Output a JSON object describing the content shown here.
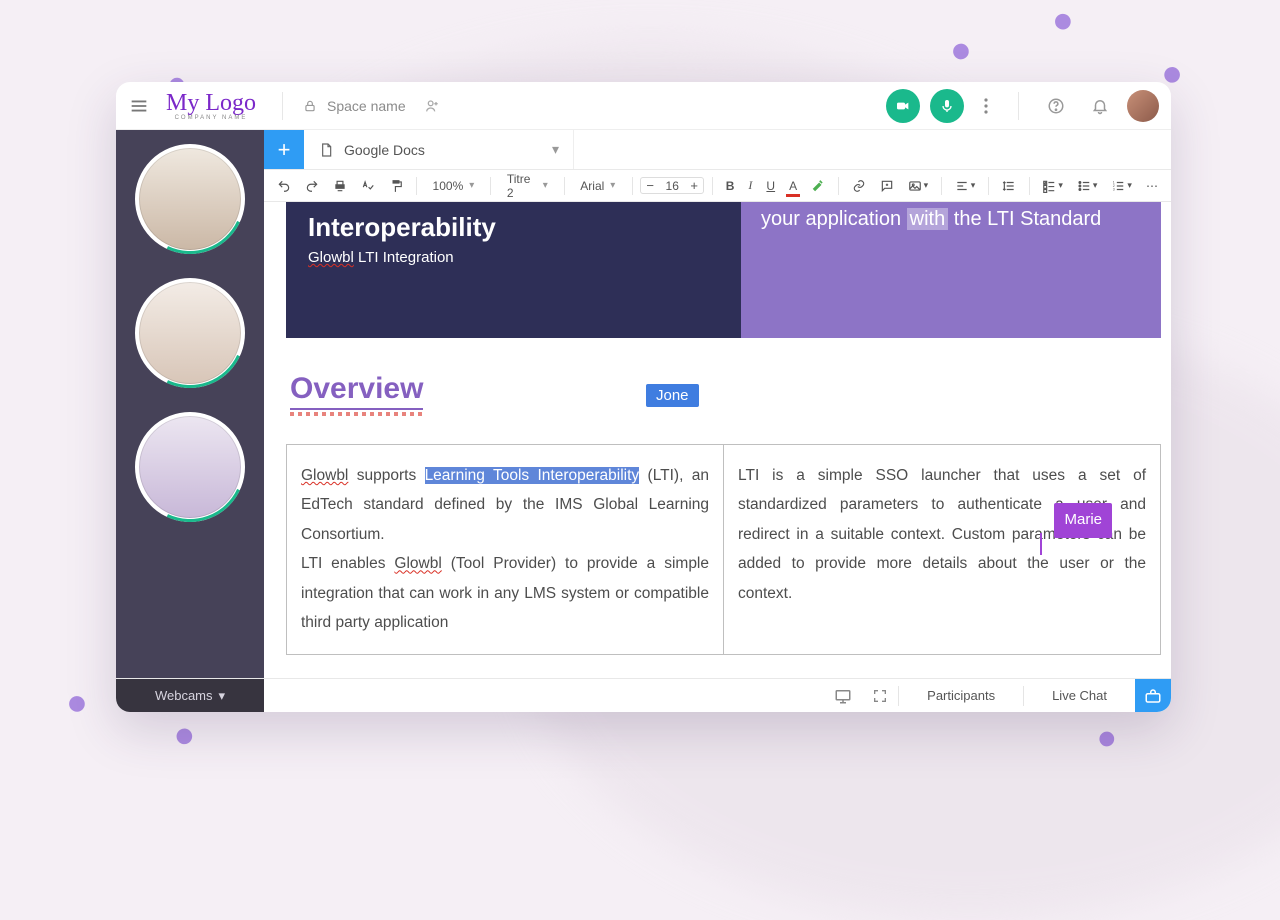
{
  "logo": {
    "main": "My Logo",
    "sub": "COMPANY NAME"
  },
  "topbar": {
    "space_name": "Space name"
  },
  "tab": {
    "source_label": "Google Docs"
  },
  "toolbar": {
    "zoom": "100%",
    "style": "Titre 2",
    "font": "Arial",
    "font_size": "16"
  },
  "doc": {
    "band_left_title": "Interoperability",
    "band_left_sub_brand": "Glowbl",
    "band_left_sub_rest": " LTI Integration",
    "band_right_pre": "your application ",
    "band_right_hl": "with",
    "band_right_post": " the LTI Standard",
    "overview_heading": "Overview",
    "col1": {
      "brand": "Glowbl",
      "part1_pre": " supports ",
      "part1_hl": "Learning Tools Interoperability",
      "part1_post": " (LTI), an EdTech standard defined by the IMS Global Learning Consortium.",
      "part2_pre": "LTI enables ",
      "part2_brand": "Glowbl",
      "part2_post": " (Tool Provider) to provide a simple integration that can work in any LMS system or compatible third party application"
    },
    "col2": "LTI is a simple SSO launcher that uses a set of standardized parameters to authenticate a user and redirect in a suitable context. Custom parameters can be added to provide more details about the user or the context."
  },
  "cursors": {
    "jone": "Jone",
    "marie": "Marie"
  },
  "bottombar": {
    "webcams": "Webcams",
    "participants": "Participants",
    "livechat": "Live Chat"
  }
}
